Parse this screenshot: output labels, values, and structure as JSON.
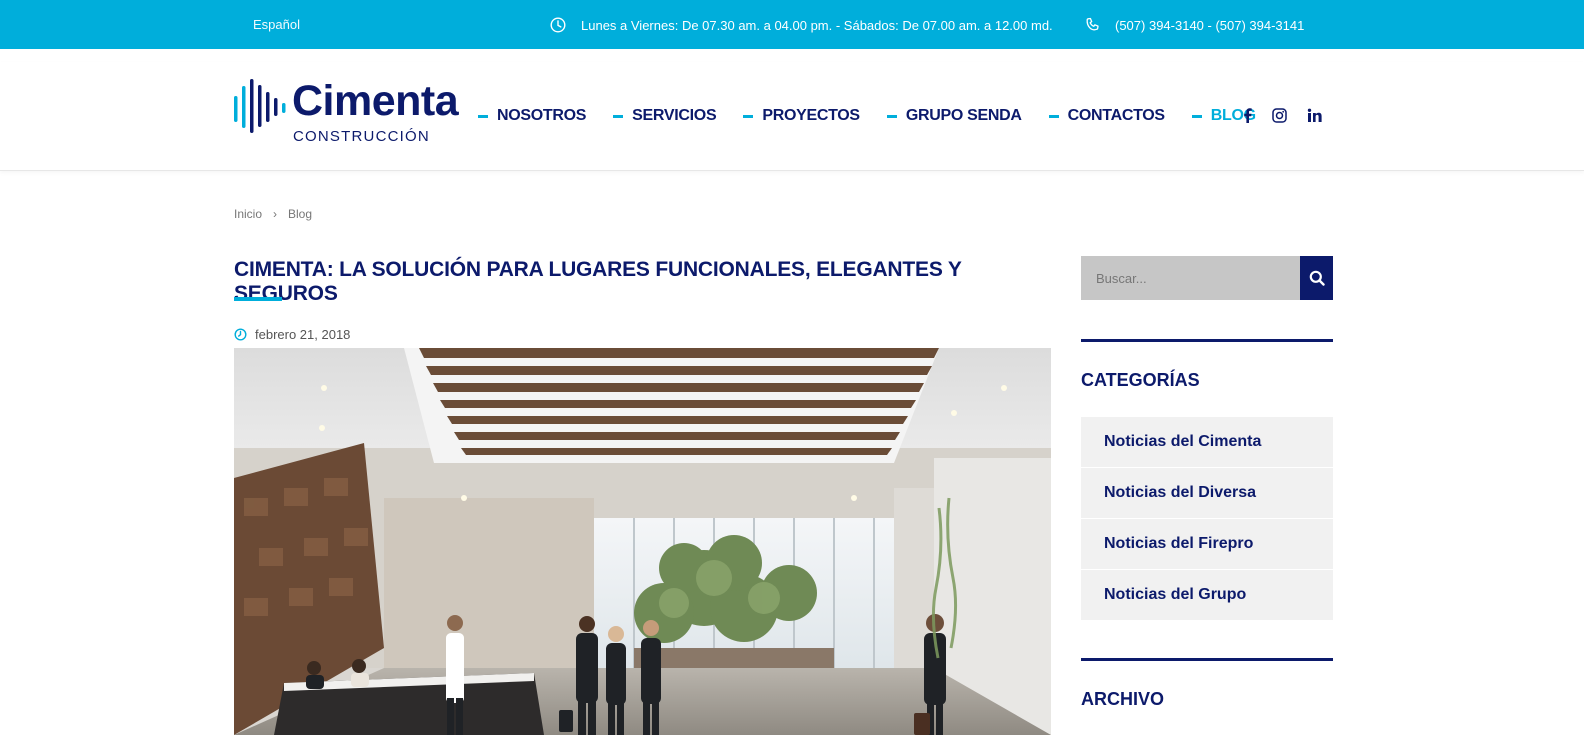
{
  "topbar": {
    "language": "Español",
    "hours": "Lunes a Viernes: De 07.30 am. a 04.00 pm. - Sábados: De 07.00 am. a 12.00 md.",
    "phones": "(507) 394-3140 - (507) 394-3141"
  },
  "logo": {
    "name": "Cimenta",
    "subtitle": "CONSTRUCCIÓN"
  },
  "nav": {
    "items": [
      {
        "label": "NOSOTROS"
      },
      {
        "label": "SERVICIOS"
      },
      {
        "label": "PROYECTOS"
      },
      {
        "label": "GRUPO SENDA"
      },
      {
        "label": "CONTACTOS"
      },
      {
        "label": "BLOG"
      }
    ],
    "active": "BLOG"
  },
  "social": [
    "facebook-icon",
    "instagram-icon",
    "linkedin-icon"
  ],
  "breadcrumb": {
    "home": "Inicio",
    "current": "Blog"
  },
  "post": {
    "title": "CIMENTA: LA SOLUCIÓN PARA LUGARES FUNCIONALES, ELEGANTES Y SEGUROS",
    "date": "febrero 21, 2018"
  },
  "sidebar": {
    "search_placeholder": "Buscar...",
    "categories_title": "CATEGORÍAS",
    "categories": [
      {
        "label": "Noticias del Cimenta"
      },
      {
        "label": "Noticias del Diversa"
      },
      {
        "label": "Noticias del Firepro"
      },
      {
        "label": "Noticias del Grupo"
      }
    ],
    "archive_title": "ARCHIVO"
  },
  "colors": {
    "accent": "#00aedb",
    "brand": "#0c1a6b",
    "category_bg": "#f1f1f1"
  }
}
